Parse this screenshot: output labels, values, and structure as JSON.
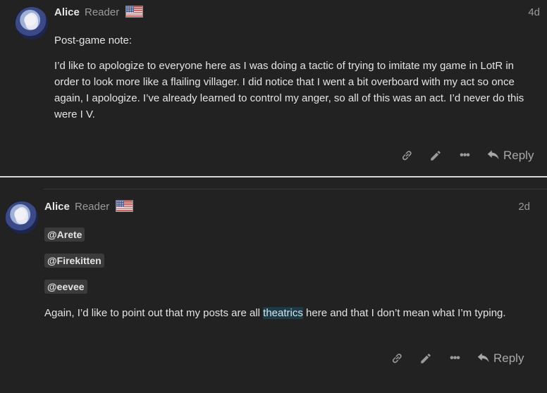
{
  "posts": [
    {
      "username": "Alice",
      "role": "Reader",
      "date": "4d",
      "note_title": "Post-game note:",
      "body": "I’d like to apologize to everyone here as I was doing a tactic of trying to imitate my game in LotR in order to look more like a flailing villager. I did notice that I went a bit overboard with my act so once again, I apologize. I’ve already learned to control my anger, so all of this was an act. I’d never do this were I V.",
      "reply_label": "Reply"
    },
    {
      "username": "Alice",
      "role": "Reader",
      "date": "2d",
      "mentions": [
        "@Arete",
        "@Firekitten",
        "@eevee"
      ],
      "text_before": "Again, I’d like to point out that my posts are all ",
      "text_highlight": "theatrics",
      "text_after": " here and that I don’t mean what I’m typing.",
      "reply_label": "Reply"
    }
  ],
  "icons": {
    "avatar": "avatar",
    "flag": "us-flag-icon",
    "link": "link-icon",
    "edit": "pencil-icon",
    "more": "ellipsis-icon",
    "reply": "reply-arrow-icon"
  },
  "colors": {
    "background": "#222222",
    "text": "#e4e4e4",
    "muted": "#9a9a9a",
    "mention_bg": "#3b3b3b",
    "highlight_bg": "#1f3a47"
  }
}
